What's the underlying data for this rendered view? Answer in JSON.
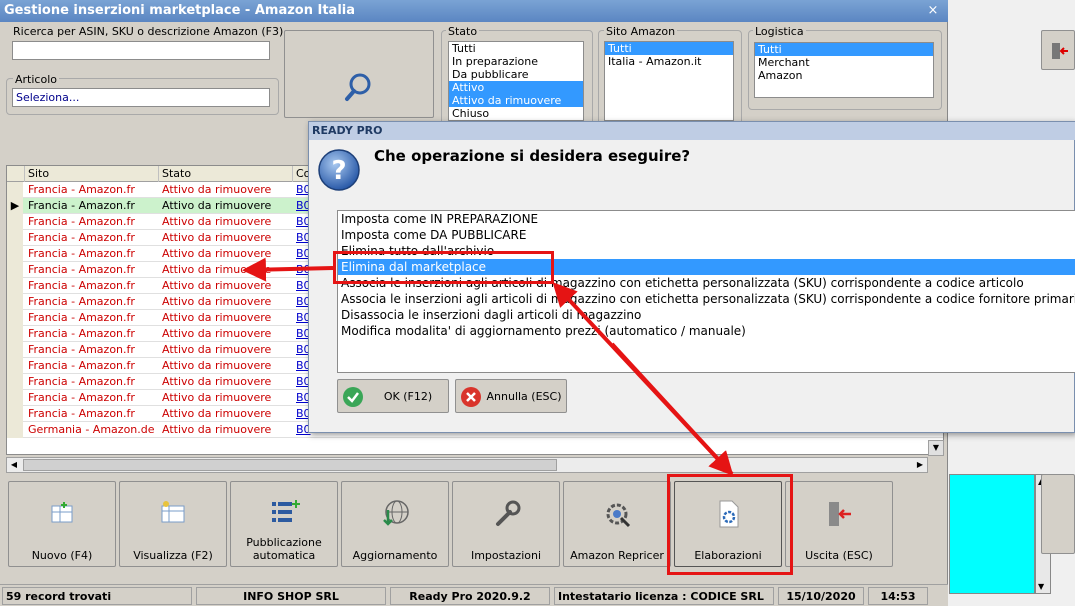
{
  "window": {
    "title": "Gestione inserzioni marketplace - Amazon Italia",
    "close_glyph": "×"
  },
  "search": {
    "label": "Ricerca per ASIN, SKU o descrizione Amazon (F3)",
    "value": ""
  },
  "article": {
    "label": "Articolo",
    "value": "Seleziona..."
  },
  "filters": {
    "stato": {
      "label": "Stato",
      "items": [
        "Tutti",
        "In preparazione",
        "Da pubblicare",
        "Attivo",
        "Attivo da rimuovere",
        "Chiuso"
      ],
      "selected": [
        3,
        4
      ]
    },
    "sito": {
      "label": "Sito Amazon",
      "items": [
        "Tutti",
        "Italia - Amazon.it"
      ],
      "selected": [
        0
      ]
    },
    "logistica": {
      "label": "Logistica",
      "items": [
        "Tutti",
        "Merchant",
        "Amazon"
      ],
      "selected": [
        0
      ]
    }
  },
  "grid": {
    "columns": [
      "Sito",
      "Stato",
      "Co"
    ],
    "current_index": 1,
    "rows": [
      {
        "sito": "Francia - Amazon.fr",
        "stato": "Attivo da rimuovere",
        "code": "B0"
      },
      {
        "sito": "Francia - Amazon.fr",
        "stato": "Attivo da rimuovere",
        "code": "B0"
      },
      {
        "sito": "Francia - Amazon.fr",
        "stato": "Attivo da rimuovere",
        "code": "B0"
      },
      {
        "sito": "Francia - Amazon.fr",
        "stato": "Attivo da rimuovere",
        "code": "B0"
      },
      {
        "sito": "Francia - Amazon.fr",
        "stato": "Attivo da rimuovere",
        "code": "B0"
      },
      {
        "sito": "Francia - Amazon.fr",
        "stato": "Attivo da rimuovere",
        "code": "B0"
      },
      {
        "sito": "Francia - Amazon.fr",
        "stato": "Attivo da rimuovere",
        "code": "B0"
      },
      {
        "sito": "Francia - Amazon.fr",
        "stato": "Attivo da rimuovere",
        "code": "B0"
      },
      {
        "sito": "Francia - Amazon.fr",
        "stato": "Attivo da rimuovere",
        "code": "B0"
      },
      {
        "sito": "Francia - Amazon.fr",
        "stato": "Attivo da rimuovere",
        "code": "B0"
      },
      {
        "sito": "Francia - Amazon.fr",
        "stato": "Attivo da rimuovere",
        "code": "B0"
      },
      {
        "sito": "Francia - Amazon.fr",
        "stato": "Attivo da rimuovere",
        "code": "B0"
      },
      {
        "sito": "Francia - Amazon.fr",
        "stato": "Attivo da rimuovere",
        "code": "B0"
      },
      {
        "sito": "Francia - Amazon.fr",
        "stato": "Attivo da rimuovere",
        "code": "B0"
      },
      {
        "sito": "Francia - Amazon.fr",
        "stato": "Attivo da rimuovere",
        "code": "B0"
      },
      {
        "sito": "Germania - Amazon.de",
        "stato": "Attivo da rimuovere",
        "code": "B0"
      }
    ]
  },
  "toolbar": {
    "buttons": [
      {
        "id": "nuovo",
        "label": "Nuovo (F4)",
        "icon": "new-record-icon"
      },
      {
        "id": "visualizza",
        "label": "Visualizza (F2)",
        "icon": "view-icon"
      },
      {
        "id": "pubblicazione",
        "label": "Pubblicazione automatica",
        "icon": "auto-publish-icon"
      },
      {
        "id": "aggiornamento",
        "label": "Aggiornamento",
        "icon": "globe-download-icon"
      },
      {
        "id": "impostazioni",
        "label": "Impostazioni",
        "icon": "wrench-icon"
      },
      {
        "id": "repricer",
        "label": "Amazon Repricer",
        "icon": "gear-search-icon"
      },
      {
        "id": "elaborazioni",
        "label": "Elaborazioni",
        "icon": "document-gear-icon"
      },
      {
        "id": "uscita",
        "label": "Uscita (ESC)",
        "icon": "exit-door-icon"
      }
    ]
  },
  "status": {
    "records": "59 record trovati",
    "company": "INFO SHOP SRL",
    "version": "Ready Pro 2020.9.2",
    "license": "Intestatario licenza : CODICE SRL",
    "date": "15/10/2020",
    "time": "14:53"
  },
  "dialog": {
    "title": "READY PRO",
    "question": "Che operazione si desidera eseguire?",
    "options": [
      "Imposta come IN PREPARAZIONE",
      "Imposta come DA PUBBLICARE",
      "Elimina tutto dall'archivio",
      "Elimina dal marketplace",
      "Associa le inserzioni agli articoli di magazzino con etichetta personalizzata (SKU) corrispondente a codice articolo",
      "Associa le inserzioni agli articoli di magazzino con etichetta personalizzata (SKU) corrispondente a codice fornitore primario",
      "Disassocia le inserzioni dagli articoli di magazzino",
      "Modifica modalita' di aggiornamento prezzi (automatico / manuale)"
    ],
    "selected_index": 3,
    "ok_label": "OK (F12)",
    "cancel_label": "Annulla (ESC)"
  },
  "colors": {
    "accent": "#3399ff",
    "annotation": "#e51414",
    "row_red": "#cc0000",
    "current_row": "#ccf2cc"
  }
}
